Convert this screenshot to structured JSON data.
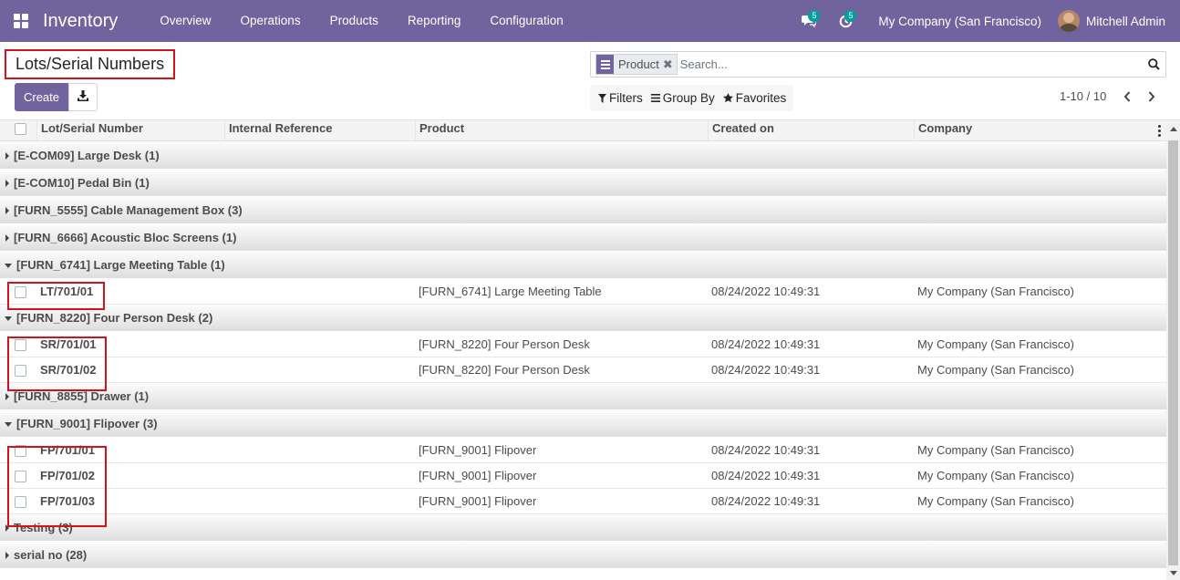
{
  "navbar": {
    "app_name": "Inventory",
    "menu": [
      "Overview",
      "Operations",
      "Products",
      "Reporting",
      "Configuration"
    ],
    "messages_badge": "5",
    "activities_badge": "5",
    "company": "My Company (San Francisco)",
    "user": "Mitchell Admin"
  },
  "control_panel": {
    "title": "Lots/Serial Numbers",
    "create_label": "Create",
    "search": {
      "facet_label": "Product",
      "placeholder": "Search..."
    },
    "filters_label": "Filters",
    "groupby_label": "Group By",
    "favorites_label": "Favorites",
    "pager": "1-10 / 10"
  },
  "columns": [
    "Lot/Serial Number",
    "Internal Reference",
    "Product",
    "Created on",
    "Company"
  ],
  "groups": [
    {
      "label": "[E-COM09] Large Desk (1)",
      "open": false
    },
    {
      "label": "[E-COM10] Pedal Bin (1)",
      "open": false
    },
    {
      "label": "[FURN_5555] Cable Management Box (3)",
      "open": false
    },
    {
      "label": "[FURN_6666] Acoustic Bloc Screens (1)",
      "open": false
    },
    {
      "label": "[FURN_6741] Large Meeting Table (1)",
      "open": true,
      "rows": [
        {
          "lot": "LT/701/01",
          "ref": "",
          "product": "[FURN_6741] Large Meeting Table",
          "created": "08/24/2022 10:49:31",
          "company": "My Company (San Francisco)"
        }
      ]
    },
    {
      "label": "[FURN_8220] Four Person Desk (2)",
      "open": true,
      "rows": [
        {
          "lot": "SR/701/01",
          "ref": "",
          "product": "[FURN_8220] Four Person Desk",
          "created": "08/24/2022 10:49:31",
          "company": "My Company (San Francisco)"
        },
        {
          "lot": "SR/701/02",
          "ref": "",
          "product": "[FURN_8220] Four Person Desk",
          "created": "08/24/2022 10:49:31",
          "company": "My Company (San Francisco)"
        }
      ]
    },
    {
      "label": "[FURN_8855] Drawer (1)",
      "open": false
    },
    {
      "label": "[FURN_9001] Flipover (3)",
      "open": true,
      "rows": [
        {
          "lot": "FP/701/01",
          "ref": "",
          "product": "[FURN_9001] Flipover",
          "created": "08/24/2022 10:49:31",
          "company": "My Company (San Francisco)"
        },
        {
          "lot": "FP/701/02",
          "ref": "",
          "product": "[FURN_9001] Flipover",
          "created": "08/24/2022 10:49:31",
          "company": "My Company (San Francisco)"
        },
        {
          "lot": "FP/701/03",
          "ref": "",
          "product": "[FURN_9001] Flipover",
          "created": "08/24/2022 10:49:31",
          "company": "My Company (San Francisco)"
        }
      ]
    },
    {
      "label": "Testing (3)",
      "open": false
    },
    {
      "label": "serial no (28)",
      "open": false
    }
  ],
  "colors": {
    "brand": "#71639e",
    "highlight": "#d0141d",
    "badge": "#00a09d"
  }
}
